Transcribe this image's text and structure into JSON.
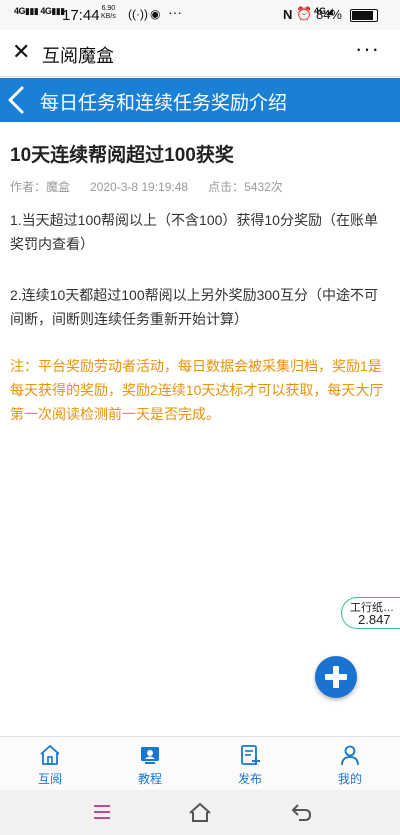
{
  "status_bar": {
    "signal1": "4G",
    "signal2": "4G",
    "time": "17:44",
    "net_speed": "6.90",
    "net_speed_unit": "KB/s",
    "net_type": "4G",
    "battery": "84%"
  },
  "app_header": {
    "title": "互阅魔盒",
    "more": "···"
  },
  "nav": {
    "title": "每日任务和连续任务奖励介绍"
  },
  "article": {
    "title": "10天连续帮阅超过100获奖",
    "author": "作者：魔盒",
    "date": "2020-3-8 19:19:48",
    "clicks": "点击：5432次",
    "paragraphs": [
      "1.当天超过100帮阅以上（不含100）获得10分奖励（在账单奖罚内查看）",
      "2.连续10天都超过100帮阅以上另外奖励300互分（中途不可间断，间断则连续任务重新开始计算）"
    ],
    "note": "注：平台奖励劳动者活动，每日数据会被采集归档，奖励1是每天获得的奖励，奖励2连续10天达标才可以获取，每天大厅第一次阅读检测前一天是否完成。"
  },
  "stock_widget": {
    "name": "工行纸…",
    "value": "2.847"
  },
  "tabs": [
    {
      "label": "互阅",
      "icon": "home-icon"
    },
    {
      "label": "教程",
      "icon": "tutorial-icon"
    },
    {
      "label": "发布",
      "icon": "publish-icon"
    },
    {
      "label": "我的",
      "icon": "profile-icon"
    }
  ],
  "colors": {
    "accent": "#1a80d6",
    "note": "#e9920a",
    "stock_border": "#3dbb8f"
  }
}
